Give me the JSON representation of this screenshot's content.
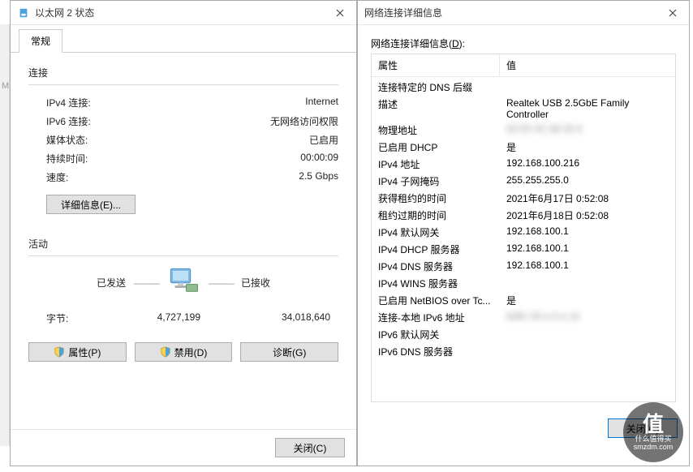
{
  "left": {
    "title": "以太网 2 状态",
    "tab_general": "常规",
    "group_connection": "连接",
    "rows": {
      "ipv4_label": "IPv4 连接:",
      "ipv4_value": "Internet",
      "ipv6_label": "IPv6 连接:",
      "ipv6_value": "无网络访问权限",
      "media_label": "媒体状态:",
      "media_value": "已启用",
      "duration_label": "持续时间:",
      "duration_value": "00:00:09",
      "speed_label": "速度:",
      "speed_value": "2.5 Gbps"
    },
    "btn_details": "详细信息(E)...",
    "group_activity": "活动",
    "activity": {
      "sent_label": "已发送",
      "recv_label": "已接收",
      "bytes_label": "字节:",
      "sent_value": "4,727,199",
      "recv_value": "34,018,640"
    },
    "btn_properties": "属性(P)",
    "btn_disable": "禁用(D)",
    "btn_diagnose": "诊断(G)",
    "btn_close": "关闭(C)"
  },
  "right": {
    "title": "网络连接详细信息",
    "label_prefix": "网络连接详细信息(",
    "label_ul": "D",
    "label_suffix": "):",
    "col_property": "属性",
    "col_value": "值",
    "rows": [
      {
        "p": "连接特定的 DNS 后缀",
        "v": ""
      },
      {
        "p": "描述",
        "v": "Realtek USB 2.5GbE Family Controller"
      },
      {
        "p": "物理地址",
        "v": "00 E0 4C 68 05 6",
        "blur": true
      },
      {
        "p": "已启用 DHCP",
        "v": "是"
      },
      {
        "p": "IPv4 地址",
        "v": "192.168.100.216"
      },
      {
        "p": "IPv4 子网掩码",
        "v": "255.255.255.0"
      },
      {
        "p": "获得租约的时间",
        "v": "2021年6月17日 0:52:08"
      },
      {
        "p": "租约过期的时间",
        "v": "2021年6月18日 0:52:08"
      },
      {
        "p": "IPv4 默认网关",
        "v": "192.168.100.1"
      },
      {
        "p": "IPv4 DHCP 服务器",
        "v": "192.168.100.1"
      },
      {
        "p": "IPv4 DNS 服务器",
        "v": "192.168.100.1"
      },
      {
        "p": "IPv4 WINS 服务器",
        "v": ""
      },
      {
        "p": "已启用 NetBIOS over Tc...",
        "v": "是"
      },
      {
        "p": "连接-本地 IPv6 地址",
        "v": "fe80::30 a 5 a 14",
        "blur": true
      },
      {
        "p": "IPv6 默认网关",
        "v": ""
      },
      {
        "p": "IPv6 DNS 服务器",
        "v": ""
      }
    ],
    "btn_close": "关闭(C)"
  },
  "watermark": {
    "char": "值",
    "text1": "什么值得买",
    "text2": "smzdm.com"
  }
}
